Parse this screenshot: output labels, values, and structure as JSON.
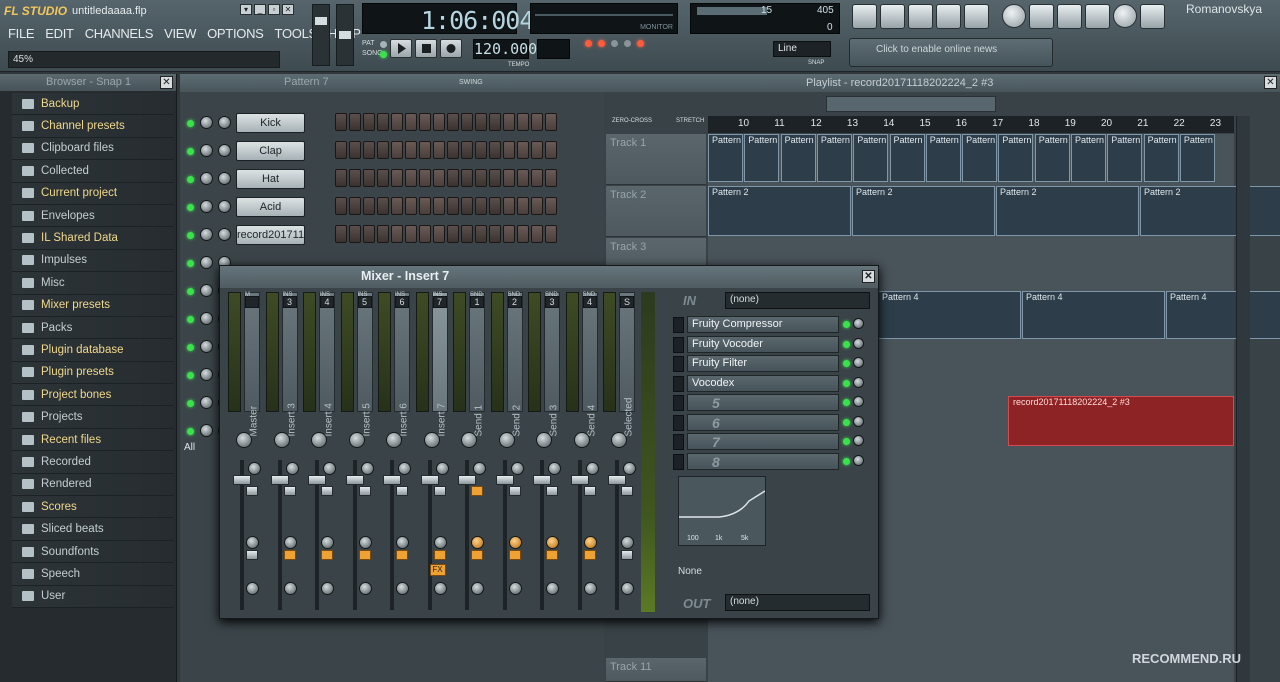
{
  "app": {
    "logo": "FL STUDIO",
    "project_file": "untitledaaaa.flp",
    "user": "Romanovskya",
    "hint": "45%"
  },
  "menu": [
    "FILE",
    "EDIT",
    "CHANNELS",
    "VIEW",
    "OPTIONS",
    "TOOLS",
    "HELP"
  ],
  "transport": {
    "time": "1:06:004",
    "tempo": "120.000",
    "tempo_label": "TEMPO",
    "pat_label": "PAT",
    "song_label": "SONG",
    "monitor_label": "MONITOR",
    "snap": "Line",
    "snap_label": "SNAP",
    "cpu_value": "15",
    "ram_value": "405",
    "poly_value": "0"
  },
  "news": {
    "text": "Click to enable online news"
  },
  "browser": {
    "title": "Browser - Snap 1",
    "items": [
      "Backup",
      "Channel presets",
      "Clipboard files",
      "Collected",
      "Current project",
      "Envelopes",
      "IL Shared Data",
      "Impulses",
      "Misc",
      "Mixer presets",
      "Packs",
      "Plugin database",
      "Plugin presets",
      "Project bones",
      "Projects",
      "Recent files",
      "Recorded",
      "Rendered",
      "Scores",
      "Sliced beats",
      "Soundfonts",
      "Speech",
      "User"
    ]
  },
  "rack": {
    "pattern": "Pattern 7",
    "swing_label": "SWING",
    "all_label": "All",
    "channels": [
      "Kick",
      "Clap",
      "Hat",
      "Acid",
      "record201711..."
    ]
  },
  "playlist": {
    "title": "Playlist - record20171118202224_2 #3",
    "zero_cross": "ZERO-CROSS",
    "stretch": "STRETCH",
    "ruler": [
      "10",
      "11",
      "12",
      "13",
      "14",
      "15",
      "16",
      "17",
      "18",
      "19",
      "20",
      "21",
      "22",
      "23"
    ],
    "tracks": [
      "Track 1",
      "Track 2",
      "Track 3",
      "Track 11"
    ],
    "clip_pattern": "Pattern",
    "clip_pattern2": "Pattern 2",
    "clip_pattern4": "Pattern 4",
    "audio_clip": "record20171118202224_2 #3"
  },
  "mixer": {
    "title": "Mixer - Insert 7",
    "strips": [
      "Master",
      "Insert 3",
      "Insert 4",
      "Insert 5",
      "Insert 6",
      "Insert 7",
      "Send 1",
      "Send 2",
      "Send 3",
      "Send 4",
      "Selected"
    ],
    "strip_tags": [
      "M",
      "INS",
      "INS",
      "INS",
      "INS",
      "INS",
      "SND",
      "SND",
      "SND",
      "SND",
      ""
    ],
    "strip_nums": [
      "",
      "3",
      "4",
      "5",
      "6",
      "7",
      "1",
      "2",
      "3",
      "4",
      "S"
    ],
    "in_label": "IN",
    "in_value": "(none)",
    "out_label": "OUT",
    "out_value": "(none)",
    "fx_slots": [
      "Fruity Compressor",
      "Fruity Vocoder",
      "Fruity Filter",
      "Vocodex",
      "5",
      "6",
      "7",
      "8"
    ],
    "eq_labels": [
      "100",
      "1k",
      "5k"
    ],
    "preset_none": "None",
    "fx_label": "FX"
  },
  "watermark": "RECOMMEND.RU"
}
